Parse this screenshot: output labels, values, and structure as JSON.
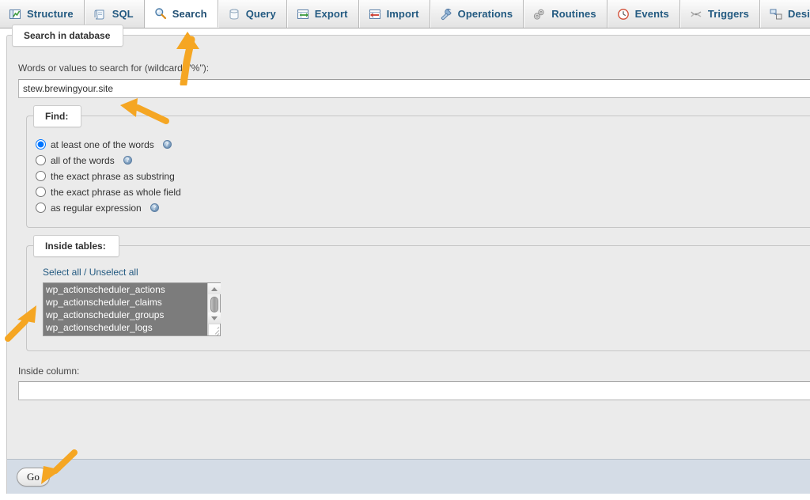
{
  "tabs": [
    {
      "label": "Structure",
      "icon": "structure-icon",
      "active": false
    },
    {
      "label": "SQL",
      "icon": "sql-icon",
      "active": false
    },
    {
      "label": "Search",
      "icon": "search-icon",
      "active": true
    },
    {
      "label": "Query",
      "icon": "query-icon",
      "active": false
    },
    {
      "label": "Export",
      "icon": "export-icon",
      "active": false
    },
    {
      "label": "Import",
      "icon": "import-icon",
      "active": false
    },
    {
      "label": "Operations",
      "icon": "wrench-icon",
      "active": false
    },
    {
      "label": "Routines",
      "icon": "routines-icon",
      "active": false
    },
    {
      "label": "Events",
      "icon": "clock-icon",
      "active": false
    },
    {
      "label": "Triggers",
      "icon": "triggers-icon",
      "active": false
    },
    {
      "label": "Designer",
      "icon": "designer-icon",
      "active": false
    }
  ],
  "panel": {
    "legend": "Search in database",
    "search_label": "Words or values to search for (wildcard: \"%\"):",
    "search_value": "stew.brewingyour.site",
    "search_placeholder": ""
  },
  "find": {
    "legend": "Find:",
    "options": [
      {
        "label": "at least one of the words",
        "checked": true,
        "help": true,
        "help_glyph": "?"
      },
      {
        "label": "all of the words",
        "checked": false,
        "help": true,
        "help_glyph": "?"
      },
      {
        "label": "the exact phrase as substring",
        "checked": false,
        "help": false,
        "help_glyph": ""
      },
      {
        "label": "the exact phrase as whole field",
        "checked": false,
        "help": false,
        "help_glyph": ""
      },
      {
        "label": "as regular expression",
        "checked": false,
        "help": true,
        "help_glyph": "?"
      }
    ]
  },
  "inside_tables": {
    "legend": "Inside tables:",
    "select_all_label": "Select all / Unselect all",
    "tables": [
      {
        "name": "wp_actionscheduler_actions",
        "selected": true
      },
      {
        "name": "wp_actionscheduler_claims",
        "selected": true
      },
      {
        "name": "wp_actionscheduler_groups",
        "selected": true
      },
      {
        "name": "wp_actionscheduler_logs",
        "selected": true
      }
    ]
  },
  "inside_column": {
    "label": "Inside column:",
    "value": "",
    "placeholder": ""
  },
  "footer": {
    "go_label": "Go"
  },
  "annotations": [
    {
      "name": "arrow-to-search-tab",
      "direction": "up"
    },
    {
      "name": "arrow-to-search-input",
      "direction": "left"
    },
    {
      "name": "arrow-to-select-all",
      "direction": "up-right"
    },
    {
      "name": "arrow-to-go-button",
      "direction": "down-left"
    }
  ],
  "colors": {
    "accent_link": "#235a81",
    "annotation_orange": "#f5a623",
    "panel_bg": "#ebebeb",
    "footer_bg": "#d4dce6",
    "select_selected_bg": "#7c7c7c"
  }
}
